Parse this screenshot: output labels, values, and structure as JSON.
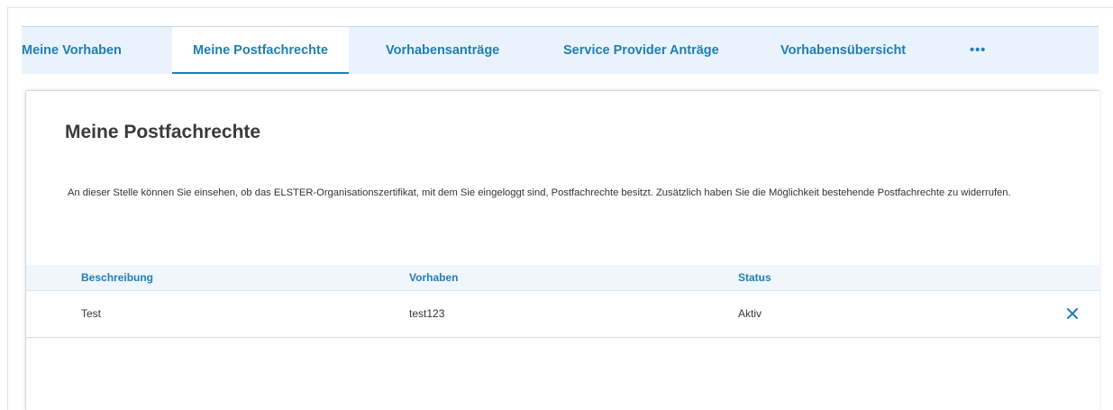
{
  "tabs": {
    "meine_vorhaben": "Meine Vorhaben",
    "meine_postfachrechte": "Meine Postfachrechte",
    "vorhabensantraege": "Vorhabensanträge",
    "service_provider_antraege": "Service Provider Anträge",
    "vorhabensuebersicht": "Vorhabensübersicht",
    "more": "•••"
  },
  "page": {
    "title": "Meine Postfachrechte",
    "description": "An dieser Stelle können Sie einsehen, ob das ELSTER-Organisationszertifikat, mit dem Sie eingeloggt sind, Postfachrechte besitzt. Zusätzlich haben Sie die Möglichkeit bestehende Postfachrechte zu widerrufen."
  },
  "table": {
    "headers": [
      "Beschreibung",
      "Vorhaben",
      "Status"
    ],
    "rows": [
      {
        "beschreibung": "Test",
        "vorhaben": "test123",
        "status": "Aktiv"
      }
    ]
  },
  "icons": {
    "revoke": "close-icon"
  },
  "colors": {
    "accent": "#1f7fb4",
    "tabbar_bg": "#eaf3fb",
    "header_bg": "#f0f6fb"
  }
}
